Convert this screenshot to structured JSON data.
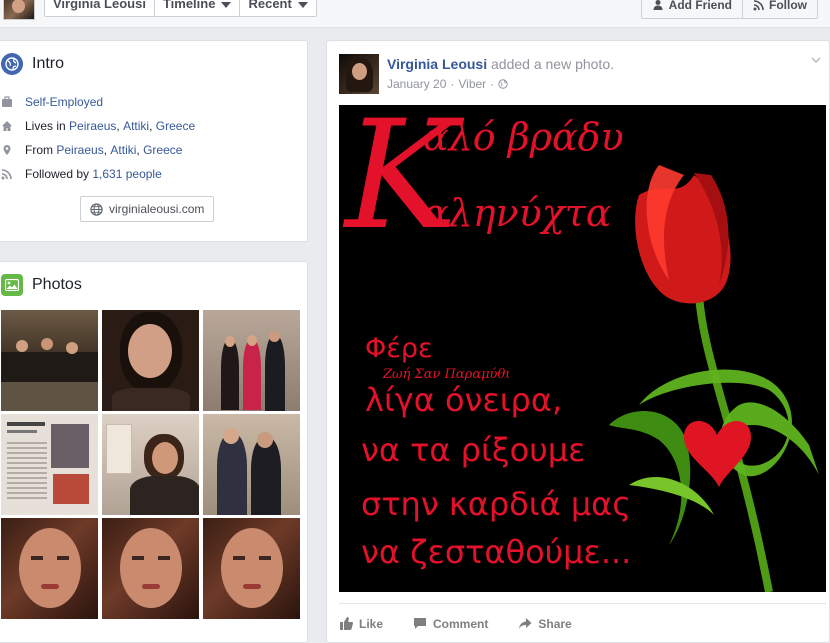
{
  "cover_bar": {
    "name": "Virginia Leousi",
    "tabs": [
      {
        "label": "Timeline"
      },
      {
        "label": "Recent"
      }
    ],
    "add_friend": "Add Friend",
    "follow": "Follow"
  },
  "intro": {
    "title": "Intro",
    "work": "Self-Employed",
    "lives_prefix": "Lives in",
    "lives_city": "Peiraeus",
    "lives_region": "Attiki",
    "lives_country": "Greece",
    "from_prefix": "From",
    "from_city": "Peiraeus",
    "from_region": "Attiki",
    "from_country": "Greece",
    "followed_prefix": "Followed by",
    "followers": "1,631 people",
    "website": "virginialeousi.com"
  },
  "photos": {
    "title": "Photos"
  },
  "post": {
    "author": "Virginia Leousi",
    "action": "added a new photo.",
    "date": "January 20",
    "source": "Viber",
    "image_text": {
      "line1": "αλό βράδυ",
      "line2": "αληνύχτα",
      "big_letter": "K",
      "phrase1": "Φέρε",
      "phrase2": "Ζωή Σαν Παραμύθι",
      "phrase3": "λίγα όνειρα,",
      "phrase4": "να τα ρίξουμε",
      "phrase5": "στην καρδιά μας",
      "phrase6": "να ζεσταθούμε..."
    },
    "like": "Like",
    "comment": "Comment",
    "share": "Share"
  },
  "colors": {
    "link": "#365899",
    "greeting_red": "#e4112a",
    "leaf_green": "#4f9b16"
  }
}
